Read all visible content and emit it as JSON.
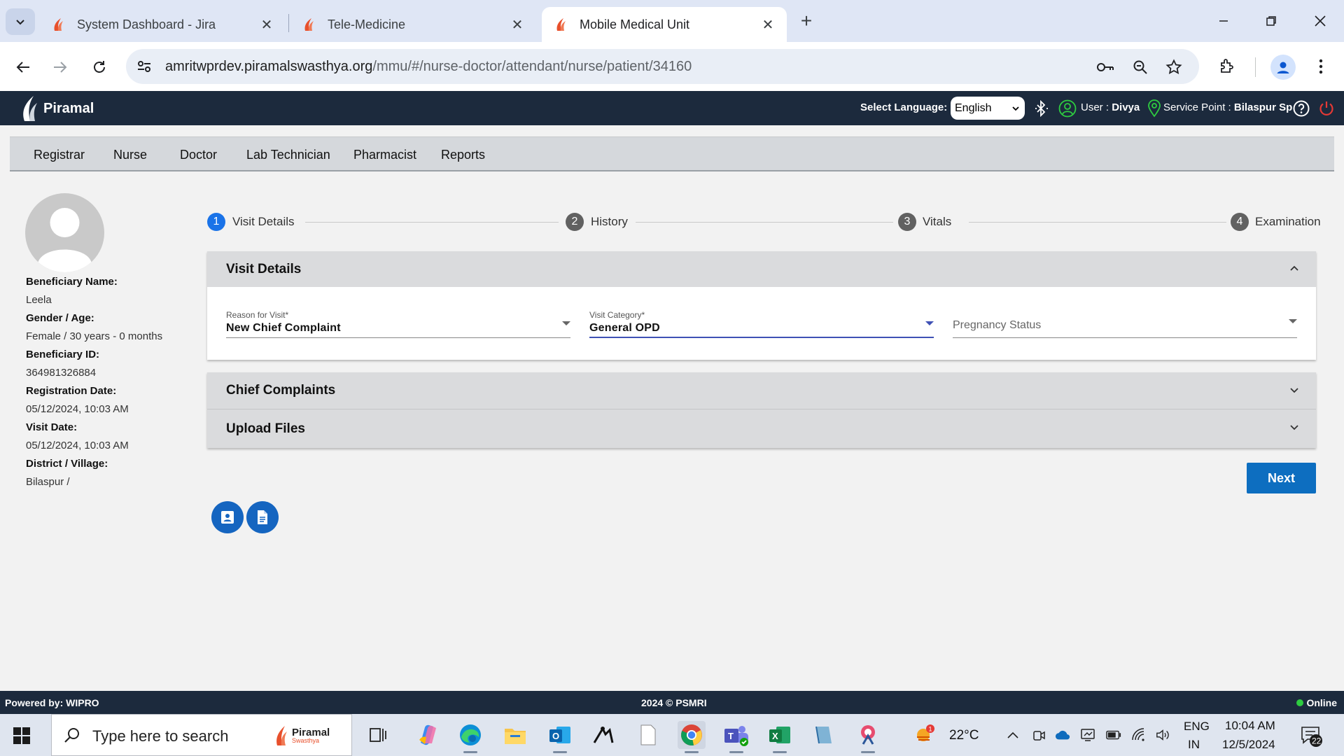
{
  "browser": {
    "tabs": [
      {
        "title": "System Dashboard - Jira"
      },
      {
        "title": "Tele-Medicine"
      },
      {
        "title": "Mobile Medical Unit"
      }
    ],
    "url_host": "amritwprdev.piramalswasthya.org",
    "url_path": "/mmu/#/nurse-doctor/attendant/nurse/patient/34160"
  },
  "header": {
    "logo_text": "Piramal",
    "language_label": "Select Language:",
    "language_value": "English",
    "user_label": "User :",
    "user_name": "Divya",
    "service_label": "Service Point :",
    "service_value": "Bilaspur Sp"
  },
  "menu": [
    "Registrar",
    "Nurse",
    "Doctor",
    "Lab Technician",
    "Pharmacist",
    "Reports"
  ],
  "beneficiary": {
    "name_label": "Beneficiary Name:",
    "name": "Leela",
    "gender_age_label": "Gender / Age:",
    "gender_age": "Female / 30 years - 0 months",
    "id_label": "Beneficiary ID:",
    "id": "364981326884",
    "reg_date_label": "Registration Date:",
    "reg_date": "05/12/2024, 10:03 AM",
    "visit_date_label": "Visit Date:",
    "visit_date": "05/12/2024, 10:03 AM",
    "district_label": "District / Village:",
    "district": "Bilaspur /"
  },
  "stepper": [
    {
      "num": "1",
      "label": "Visit Details"
    },
    {
      "num": "2",
      "label": "History"
    },
    {
      "num": "3",
      "label": "Vitals"
    },
    {
      "num": "4",
      "label": "Examination"
    }
  ],
  "visit_details": {
    "title": "Visit Details",
    "reason_label": "Reason for Visit*",
    "reason_value": "New Chief Complaint",
    "category_label": "Visit Category*",
    "category_value": "General OPD",
    "pregnancy_placeholder": "Pregnancy Status"
  },
  "chief_complaints": {
    "title": "Chief Complaints"
  },
  "upload_files": {
    "title": "Upload Files"
  },
  "next_label": "Next",
  "footer": {
    "left": "Powered by: WIPRO",
    "center": "2024 © PSMRI",
    "right": "Online"
  },
  "taskbar": {
    "search_placeholder": "Type here to search",
    "search_brand": "Piramal",
    "search_brand_sub": "Swasthya",
    "weather": "22°C",
    "weather_badge": "1",
    "lang_top": "ENG",
    "lang_bottom": "IN",
    "time": "10:04 AM",
    "date": "12/5/2024",
    "notif_count": "22"
  },
  "colors": {
    "header_bg": "#1c2a3d",
    "step_active": "#1a73e8",
    "step_inactive": "#616161",
    "primary_button": "#0d6ec0",
    "online": "#2ecc40"
  }
}
